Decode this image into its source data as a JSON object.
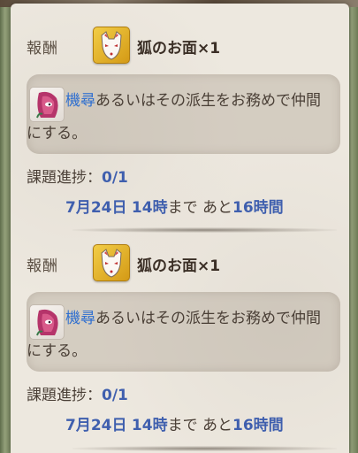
{
  "quests": [
    {
      "reward_label": "報酬",
      "reward_item": "狐のお面×1",
      "reward_icon": "fox-mask-icon",
      "char_icon": "character-portrait-icon",
      "description_highlight": "機尋",
      "description_rest": "あるいはその派生をお務めで仲間にする。",
      "progress_label": "課題進捗：",
      "progress_value": "0/1",
      "deadline_date": "7月24日",
      "deadline_hour": "14時",
      "deadline_until": "まで",
      "deadline_remaining_prefix": "あと",
      "deadline_remaining": "16時間"
    },
    {
      "reward_label": "報酬",
      "reward_item": "狐のお面×1",
      "reward_icon": "fox-mask-icon",
      "char_icon": "character-portrait-icon",
      "description_highlight": "機尋",
      "description_rest": "あるいはその派生をお務めで仲間にする。",
      "progress_label": "課題進捗：",
      "progress_value": "0/1",
      "deadline_date": "7月24日",
      "deadline_hour": "14時",
      "deadline_until": "まで",
      "deadline_remaining_prefix": "あと",
      "deadline_remaining": "16時間"
    }
  ]
}
